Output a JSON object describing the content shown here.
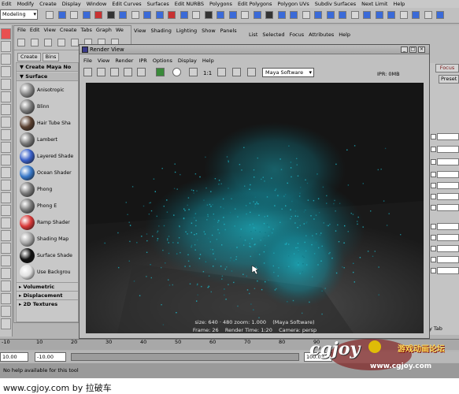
{
  "main_menu": [
    "Edit",
    "Modify",
    "Create",
    "Display",
    "Window",
    "Edit Curves",
    "Surfaces",
    "Edit NURBS",
    "Polygons",
    "Edit Polygons",
    "Polygon UVs",
    "Subdiv Surfaces",
    "Next Limit",
    "Help"
  ],
  "mode_select": "Modeling",
  "hypershade": {
    "menu": [
      "File",
      "Edit",
      "View",
      "Create",
      "Tabs",
      "Graph",
      "We"
    ],
    "tabs": [
      "Create",
      "Bins"
    ],
    "create_header": "Create Maya No",
    "surface_header": "Surface",
    "materials": [
      {
        "label": "Anisotropic",
        "color": "#8a8a8a"
      },
      {
        "label": "Blinn",
        "color": "#7a7a7a"
      },
      {
        "label": "Hair Tube Sha",
        "color": "#5a4030"
      },
      {
        "label": "Lambert",
        "color": "#777777"
      },
      {
        "label": "Layered Shade",
        "color": "#3a60c8"
      },
      {
        "label": "Ocean Shader",
        "color": "#3878c8"
      },
      {
        "label": "Phong",
        "color": "#7a7a7a"
      },
      {
        "label": "Phong E",
        "color": "#7a7a7a"
      },
      {
        "label": "Ramp Shader",
        "color": "#d83838"
      },
      {
        "label": "Shading Map",
        "color": "#a8a8a8"
      },
      {
        "label": "Surface Shade",
        "color": "#111111"
      },
      {
        "label": "Use Backgrou",
        "color": "#e0e0e0"
      }
    ],
    "sections": [
      "Volumetric",
      "Displacement",
      "2D Textures"
    ]
  },
  "view_menu": [
    "View",
    "Shading",
    "Lighting",
    "Show",
    "Panels"
  ],
  "attr_menu": [
    "List",
    "Selected",
    "Focus",
    "Attributes",
    "Help"
  ],
  "right_panel": {
    "focus": "Focus",
    "presets": "Preset",
    "tab": "y Tab"
  },
  "render_view": {
    "title": "Render View",
    "menu": [
      "File",
      "View",
      "Render",
      "IPR",
      "Options",
      "Display",
      "Help"
    ],
    "ratio": "1:1",
    "renderer": "Maya Software",
    "ipr": "IPR: 0MB",
    "info_size": "size:  640 · 480 zoom: 1.000",
    "info_renderer": "(Maya Software)",
    "info_frame": "Frame: 26",
    "info_time": "Render Time: 1:20",
    "info_camera": "Camera: persp"
  },
  "time_slider": {
    "ticks": [
      "-10",
      "10",
      "20",
      "30",
      "40",
      "50",
      "60",
      "70",
      "80",
      "90"
    ]
  },
  "range": {
    "start": "10.00",
    "inner_start": "-10.00",
    "end": "100.00"
  },
  "help_line": "No help available for this tool",
  "watermark": {
    "bottom": "www.cgjoy.com by 拉破车",
    "logo": "cgjoy",
    "cn": "游戏动画论坛",
    "url": "www.cgjoy.com"
  }
}
